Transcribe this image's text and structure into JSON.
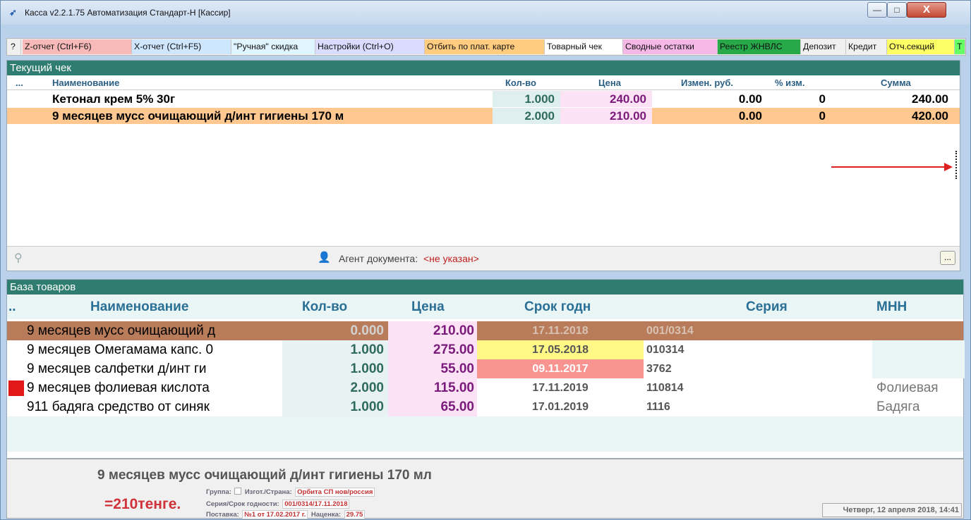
{
  "window": {
    "title": "Касса v2.2.1.75 Автоматизация Стандарт-Н [Кассир]"
  },
  "window_controls": {
    "minimize": "—",
    "maximize": "□",
    "close": "X"
  },
  "toolbar": {
    "items": [
      {
        "label": "?",
        "bg": "#f0f0f0"
      },
      {
        "label": "Z-отчет (Ctrl+F6)",
        "bg": "#f8b9b9"
      },
      {
        "label": "X-отчет (Ctrl+F5)",
        "bg": "#cfe6ff"
      },
      {
        "label": "\"Ручная\" скидка",
        "bg": "#dff5ff"
      },
      {
        "label": "Настройки (Ctrl+O)",
        "bg": "#d9dcff"
      },
      {
        "label": "Отбить по плат. карте",
        "bg": "#ffcc80"
      },
      {
        "label": "Товарный чек",
        "bg": "#ffffff"
      },
      {
        "label": "Сводные остатки",
        "bg": "#f4b7e6"
      },
      {
        "label": "Реестр ЖНВЛС",
        "bg": "#27a94a"
      },
      {
        "label": "Депозит",
        "bg": "#f0f0f0"
      },
      {
        "label": "Кредит",
        "bg": "#f0f0f0"
      },
      {
        "label": "Отч.секций",
        "bg": "#ffff66"
      },
      {
        "label": "Т",
        "bg": "#66ff66"
      }
    ]
  },
  "current_check": {
    "title": "Текущий чек",
    "columns": {
      "dots": "...",
      "name": "Наименование",
      "qty": "Кол-во",
      "price": "Цена",
      "change": "Измен. руб.",
      "pct": "% изм.",
      "sum": "Сумма"
    },
    "rows": [
      {
        "name": "Кетонал крем 5% 30г",
        "qty": "1.000",
        "price": "240.00",
        "change": "0.00",
        "pct": "0",
        "sum": "240.00"
      },
      {
        "name": "9 месяцев мусс очищающий д/инт гигиены 170 м",
        "qty": "2.000",
        "price": "210.00",
        "change": "0.00",
        "pct": "0",
        "sum": "420.00"
      }
    ],
    "agent_label": "Агент документа:",
    "agent_value": "<не указан>",
    "more_button": "..."
  },
  "product_base": {
    "title": "База товаров",
    "columns": {
      "dots": "..",
      "name": "Наименование",
      "qty": "Кол-во",
      "price": "Цена",
      "expiry": "Срок годн",
      "series": "Серия",
      "inn": "МНН"
    },
    "rows": [
      {
        "name": "9 месяцев мусс очищающий д",
        "qty": "0.000",
        "price": "210.00",
        "expiry": "17.11.2018",
        "series": "001/0314",
        "inn": ""
      },
      {
        "name": "9 месяцев Омегамама капс. 0",
        "qty": "1.000",
        "price": "275.00",
        "expiry": "17.05.2018",
        "series": "010314",
        "inn": ""
      },
      {
        "name": "9 месяцев салфетки  д/инт ги",
        "qty": "1.000",
        "price": "55.00",
        "expiry": "09.11.2017",
        "series": "3762",
        "inn": ""
      },
      {
        "name": "9 месяцев фолиевая кислота",
        "qty": "2.000",
        "price": "115.00",
        "expiry": "17.11.2019",
        "series": "110814",
        "inn": "Фолиевая"
      },
      {
        "name": "911 бадяга средство от синяк",
        "qty": "1.000",
        "price": "65.00",
        "expiry": "17.01.2019",
        "series": "1116",
        "inn": "Бадяга"
      }
    ]
  },
  "info": {
    "product_name": "9 месяцев мусс очищающий д/инт гигиены 170 мл",
    "price_label": "=210тенге.",
    "group_label": "Группа:",
    "maker_label": "Изгот./Страна:",
    "maker_value": "Орбита СП нов/россия",
    "series_label": "Серия/Срок годности:",
    "series_value": "001/0314/17.11.2018",
    "supply_label": "Поставка:",
    "supply_value": "№1 от 17.02.2017 г.",
    "markup_label": "Наценка:",
    "markup_value": "29.75",
    "datetime": "Четверг, 12 апреля 2018, 14:41"
  },
  "colors": {
    "header_teal": "#2e7d70",
    "selected_row": "#b87c5a",
    "highlight_row": "#ffc890",
    "price_purple": "#7a1a7a",
    "qty_green": "#2e6a5e"
  }
}
